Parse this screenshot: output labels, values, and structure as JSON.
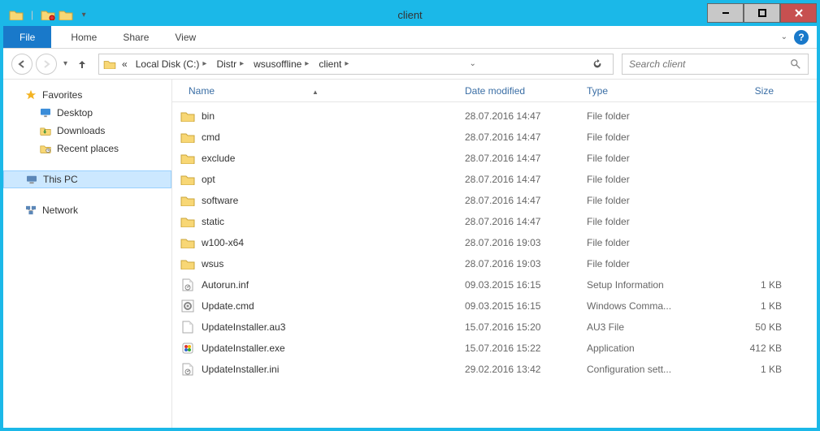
{
  "window": {
    "title": "client"
  },
  "tabs": {
    "file": "File",
    "home": "Home",
    "share": "Share",
    "view": "View"
  },
  "address": {
    "segments": [
      "Local Disk (C:)",
      "Distr",
      "wsusoffline",
      "client"
    ],
    "prefix": "«"
  },
  "search": {
    "placeholder": "Search client"
  },
  "sidebar": {
    "favorites": {
      "label": "Favorites",
      "items": [
        "Desktop",
        "Downloads",
        "Recent places"
      ]
    },
    "thispc": {
      "label": "This PC"
    },
    "network": {
      "label": "Network"
    }
  },
  "columns": {
    "name": "Name",
    "date": "Date modified",
    "type": "Type",
    "size": "Size"
  },
  "files": [
    {
      "name": "bin",
      "date": "28.07.2016 14:47",
      "type": "File folder",
      "size": "",
      "kind": "folder"
    },
    {
      "name": "cmd",
      "date": "28.07.2016 14:47",
      "type": "File folder",
      "size": "",
      "kind": "folder"
    },
    {
      "name": "exclude",
      "date": "28.07.2016 14:47",
      "type": "File folder",
      "size": "",
      "kind": "folder"
    },
    {
      "name": "opt",
      "date": "28.07.2016 14:47",
      "type": "File folder",
      "size": "",
      "kind": "folder"
    },
    {
      "name": "software",
      "date": "28.07.2016 14:47",
      "type": "File folder",
      "size": "",
      "kind": "folder"
    },
    {
      "name": "static",
      "date": "28.07.2016 14:47",
      "type": "File folder",
      "size": "",
      "kind": "folder"
    },
    {
      "name": "w100-x64",
      "date": "28.07.2016 19:03",
      "type": "File folder",
      "size": "",
      "kind": "folder"
    },
    {
      "name": "wsus",
      "date": "28.07.2016 19:03",
      "type": "File folder",
      "size": "",
      "kind": "folder"
    },
    {
      "name": "Autorun.inf",
      "date": "09.03.2015 16:15",
      "type": "Setup Information",
      "size": "1 KB",
      "kind": "inf"
    },
    {
      "name": "Update.cmd",
      "date": "09.03.2015 16:15",
      "type": "Windows Comma...",
      "size": "1 KB",
      "kind": "cmd"
    },
    {
      "name": "UpdateInstaller.au3",
      "date": "15.07.2016 15:20",
      "type": "AU3 File",
      "size": "50 KB",
      "kind": "au3"
    },
    {
      "name": "UpdateInstaller.exe",
      "date": "15.07.2016 15:22",
      "type": "Application",
      "size": "412 KB",
      "kind": "exe"
    },
    {
      "name": "UpdateInstaller.ini",
      "date": "29.02.2016 13:42",
      "type": "Configuration sett...",
      "size": "1 KB",
      "kind": "ini"
    }
  ]
}
